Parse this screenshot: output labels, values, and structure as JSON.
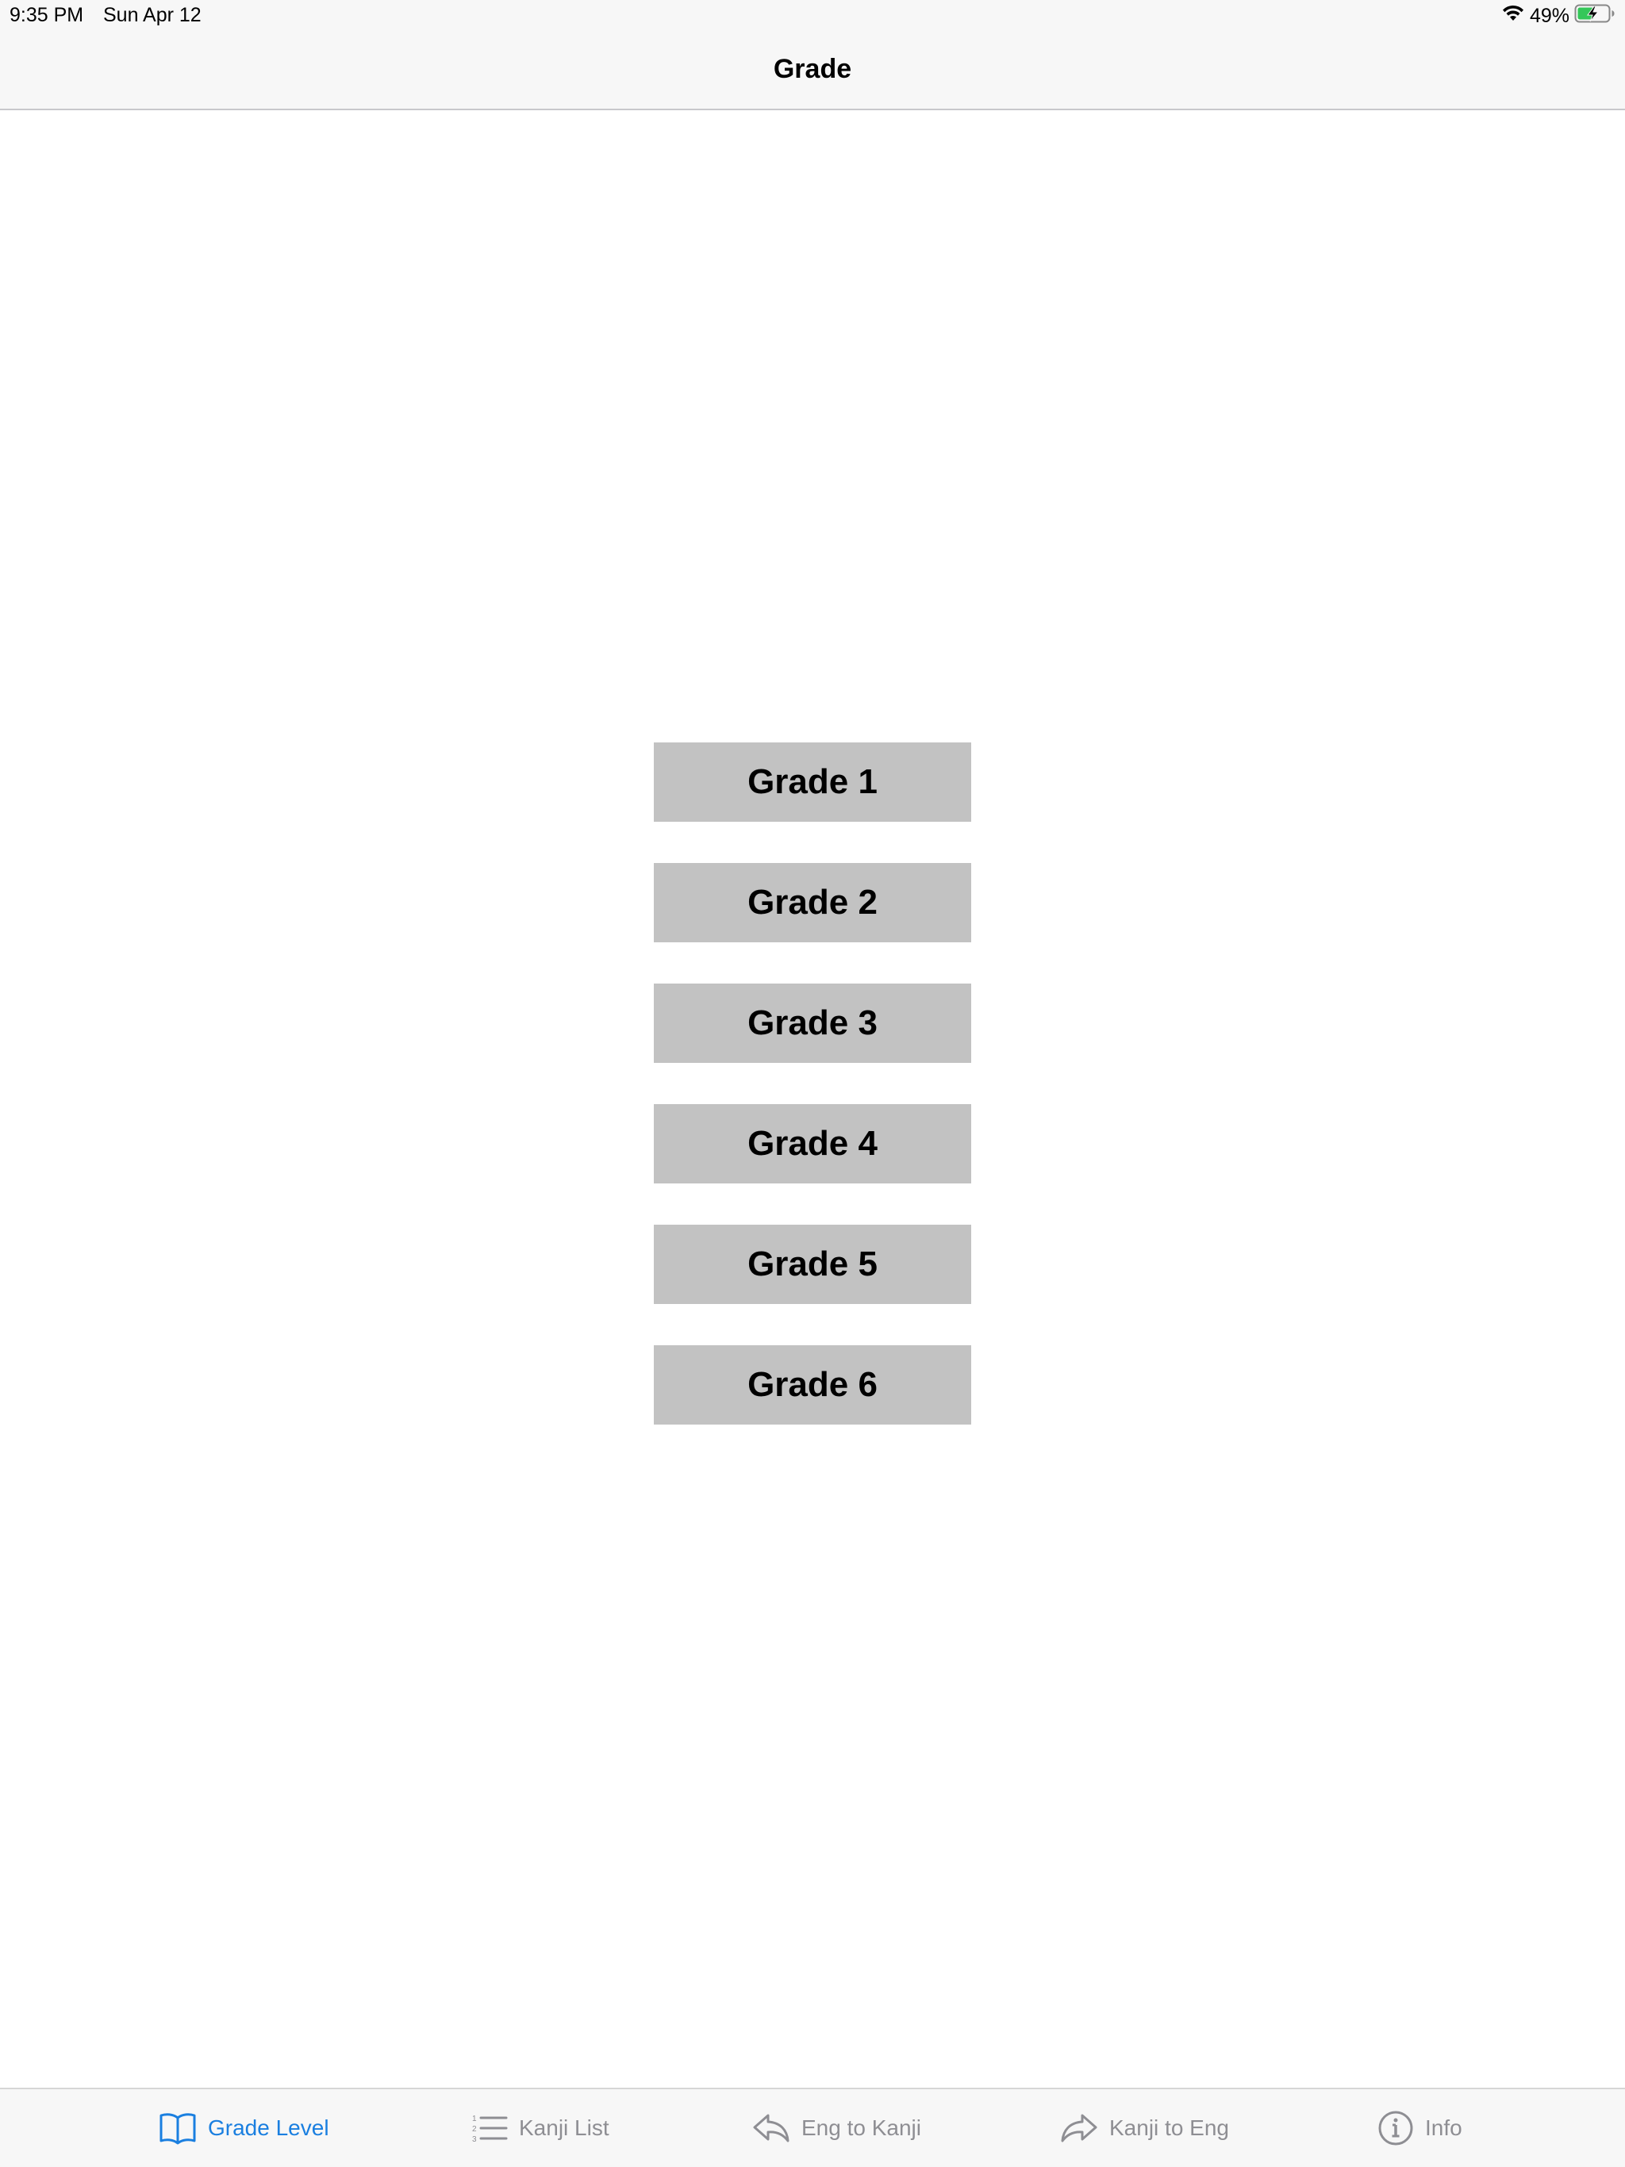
{
  "status_bar": {
    "time": "9:35 PM",
    "date": "Sun Apr 12",
    "battery": "49%",
    "wifi_icon": "wifi-icon",
    "battery_icon": "battery-charging-icon"
  },
  "nav_bar": {
    "title": "Grade"
  },
  "grades": [
    {
      "label": "Grade 1"
    },
    {
      "label": "Grade 2"
    },
    {
      "label": "Grade 3"
    },
    {
      "label": "Grade 4"
    },
    {
      "label": "Grade 5"
    },
    {
      "label": "Grade 6"
    }
  ],
  "tab_bar": {
    "items": [
      {
        "label": "Grade Level",
        "icon": "book-icon",
        "active": true
      },
      {
        "label": "Kanji List",
        "icon": "numbered-list-icon",
        "active": false
      },
      {
        "label": "Eng to Kanji",
        "icon": "reply-arrow-icon",
        "active": false
      },
      {
        "label": "Kanji to Eng",
        "icon": "forward-arrow-icon",
        "active": false
      },
      {
        "label": "Info",
        "icon": "info-icon",
        "active": false
      }
    ]
  },
  "colors": {
    "accent": "#1a7fe0",
    "inactive": "#8e8e93",
    "button_bg": "#c2c2c2",
    "bar_bg": "#f7f7f7",
    "battery_fill": "#34c759"
  }
}
